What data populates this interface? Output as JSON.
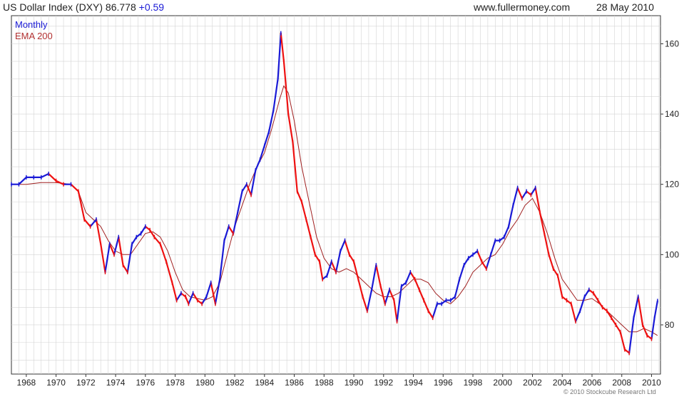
{
  "header": {
    "title": "US Dollar Index (DXY) 86.778",
    "change": "+0.59",
    "site": "www.fullermoney.com",
    "date": "28 May 2010"
  },
  "copyright": "© 2010 Stockcube Research Ltd",
  "colors": {
    "up": "#1a1ad6",
    "down": "#ee1111",
    "ema": "#a02020",
    "grid": "#d4d4d4"
  },
  "chart_data": {
    "type": "line",
    "title": "US Dollar Index (DXY)",
    "xlim": [
      1967,
      2010.6
    ],
    "ylim": [
      66,
      168
    ],
    "grid": true,
    "legend_placement": "top-left",
    "x_ticks": [
      1968,
      1970,
      1972,
      1974,
      1976,
      1978,
      1980,
      1982,
      1984,
      1986,
      1988,
      1990,
      1992,
      1994,
      1996,
      1998,
      2000,
      2002,
      2004,
      2006,
      2008,
      2010
    ],
    "x_tick_labels": [
      "1968",
      "1970",
      "1972",
      "1974",
      "1976",
      "1978",
      "1980",
      "1982",
      "1984",
      "1986",
      "1988",
      "1990",
      "1992",
      "1994",
      "1996",
      "1998",
      "2000",
      "2002",
      "2004",
      "2006",
      "2008",
      "2010"
    ],
    "y_ticks": [
      80,
      100,
      120,
      140,
      160
    ],
    "y_tick_labels": [
      "80",
      "100",
      "120",
      "140",
      "160"
    ],
    "series": [
      {
        "name": "Monthly",
        "x": [
          1967.0,
          1967.5,
          1968.0,
          1968.5,
          1969.0,
          1969.5,
          1970.0,
          1970.5,
          1971.0,
          1971.5,
          1971.9,
          1972.3,
          1972.7,
          1973.0,
          1973.3,
          1973.6,
          1973.9,
          1974.2,
          1974.5,
          1974.8,
          1975.1,
          1975.4,
          1975.7,
          1976.0,
          1976.3,
          1976.6,
          1977.0,
          1977.4,
          1977.8,
          1978.1,
          1978.4,
          1978.7,
          1978.9,
          1979.2,
          1979.5,
          1979.8,
          1980.1,
          1980.4,
          1980.7,
          1981.0,
          1981.3,
          1981.6,
          1981.9,
          1982.2,
          1982.5,
          1982.8,
          1983.1,
          1983.4,
          1983.7,
          1984.0,
          1984.3,
          1984.6,
          1984.9,
          1985.1,
          1985.3,
          1985.6,
          1985.9,
          1986.2,
          1986.5,
          1986.8,
          1987.1,
          1987.4,
          1987.7,
          1987.9,
          1988.2,
          1988.5,
          1988.8,
          1989.1,
          1989.4,
          1989.7,
          1990.0,
          1990.3,
          1990.6,
          1990.9,
          1991.2,
          1991.5,
          1991.8,
          1992.1,
          1992.4,
          1992.7,
          1992.9,
          1993.2,
          1993.5,
          1993.8,
          1994.1,
          1994.4,
          1994.7,
          1995.0,
          1995.3,
          1995.6,
          1995.9,
          1996.2,
          1996.5,
          1996.8,
          1997.1,
          1997.4,
          1997.7,
          1998.0,
          1998.3,
          1998.6,
          1998.9,
          1999.2,
          1999.5,
          1999.8,
          2000.1,
          2000.4,
          2000.7,
          2001.0,
          2001.3,
          2001.6,
          2001.9,
          2002.2,
          2002.5,
          2002.8,
          2003.1,
          2003.4,
          2003.7,
          2004.0,
          2004.3,
          2004.6,
          2004.9,
          2005.2,
          2005.5,
          2005.8,
          2006.1,
          2006.4,
          2006.7,
          2007.0,
          2007.3,
          2007.6,
          2007.9,
          2008.2,
          2008.5,
          2008.8,
          2009.1,
          2009.4,
          2009.7,
          2010.0,
          2010.2,
          2010.4
        ],
        "y": [
          120,
          120,
          122,
          122,
          122,
          123,
          121,
          120,
          120,
          118,
          110,
          108,
          110,
          103,
          95,
          103,
          100,
          105,
          97,
          95,
          103,
          105,
          106,
          108,
          107,
          105,
          103,
          98,
          92,
          87,
          89,
          88,
          86,
          89,
          87,
          86,
          88,
          92,
          86,
          93,
          104,
          108,
          106,
          112,
          118,
          120,
          117,
          124,
          127,
          131,
          135,
          141,
          150,
          163,
          155,
          140,
          132,
          118,
          115,
          110,
          105,
          100,
          98,
          93,
          94,
          98,
          95,
          101,
          104,
          100,
          98,
          93,
          88,
          84,
          90,
          97,
          91,
          86,
          90,
          87,
          81,
          91,
          92,
          95,
          93,
          90,
          87,
          84,
          82,
          86,
          86,
          87,
          87,
          88,
          93,
          97,
          99,
          100,
          101,
          98,
          96,
          100,
          104,
          104,
          105,
          108,
          114,
          119,
          116,
          118,
          117,
          119,
          112,
          106,
          100,
          96,
          94,
          88,
          87,
          86,
          81,
          84,
          88,
          90,
          89,
          87,
          85,
          84,
          82,
          80,
          78,
          73,
          72,
          82,
          88,
          80,
          77,
          76,
          82,
          86.8
        ]
      },
      {
        "name": "EMA 200",
        "x": [
          1967.0,
          1968.0,
          1969.0,
          1970.0,
          1971.0,
          1971.5,
          1972.0,
          1972.5,
          1973.0,
          1973.5,
          1974.0,
          1974.5,
          1975.0,
          1975.5,
          1976.0,
          1976.5,
          1977.0,
          1977.5,
          1978.0,
          1978.5,
          1979.0,
          1979.5,
          1980.0,
          1980.5,
          1981.0,
          1981.5,
          1982.0,
          1982.5,
          1983.0,
          1983.5,
          1984.0,
          1984.5,
          1985.0,
          1985.3,
          1985.6,
          1986.0,
          1986.5,
          1987.0,
          1987.5,
          1988.0,
          1988.5,
          1989.0,
          1989.5,
          1990.0,
          1990.5,
          1991.0,
          1991.5,
          1992.0,
          1992.5,
          1993.0,
          1993.5,
          1994.0,
          1994.5,
          1995.0,
          1995.5,
          1996.0,
          1996.5,
          1997.0,
          1997.5,
          1998.0,
          1998.5,
          1999.0,
          1999.5,
          2000.0,
          2000.5,
          2001.0,
          2001.5,
          2002.0,
          2002.5,
          2003.0,
          2003.5,
          2004.0,
          2004.5,
          2005.0,
          2005.5,
          2006.0,
          2006.5,
          2007.0,
          2007.5,
          2008.0,
          2008.5,
          2009.0,
          2009.5,
          2010.0,
          2010.4
        ],
        "y": [
          120,
          120,
          120.5,
          120.5,
          120,
          118,
          112,
          110,
          108,
          104,
          101,
          100,
          100,
          103,
          106,
          106.5,
          105,
          101,
          95,
          90,
          88,
          87.5,
          87,
          88,
          92,
          100,
          108,
          114,
          120,
          125,
          129,
          136,
          144,
          148,
          146,
          138,
          125,
          115,
          105,
          99,
          96,
          95,
          96,
          95,
          93,
          91,
          89,
          88,
          88,
          89,
          91,
          93,
          93,
          92,
          89,
          87,
          86,
          88,
          91,
          95,
          97,
          99,
          100,
          103,
          107,
          110,
          114,
          116,
          112,
          106,
          99,
          93,
          90,
          87,
          87,
          87.5,
          86,
          84,
          82,
          80,
          78,
          78,
          79,
          78,
          77
        ]
      }
    ]
  }
}
